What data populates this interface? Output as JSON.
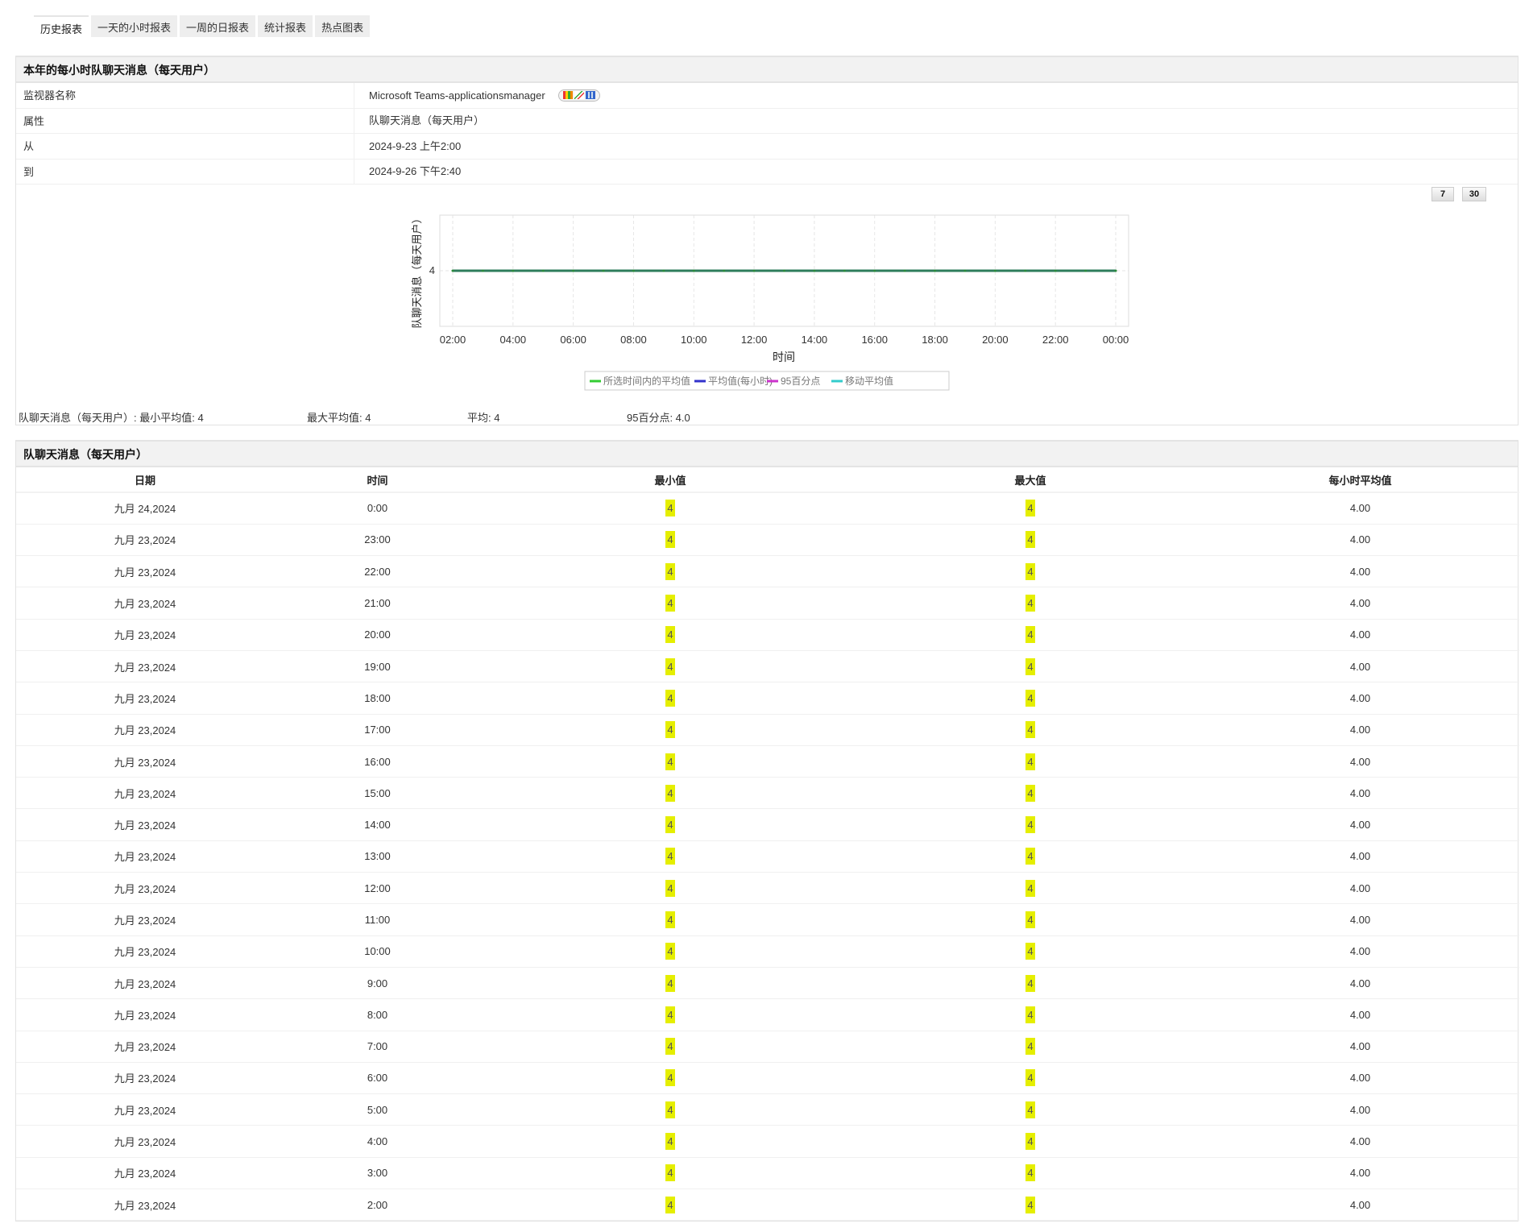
{
  "tabs": [
    "历史报表",
    "一天的小时报表",
    "一周的日报表",
    "统计报表",
    "热点图表"
  ],
  "panel1": {
    "title": "本年的每小时队聊天消息（每天用户）",
    "rows": [
      {
        "label": "监视器名称",
        "value": "Microsoft Teams-applicationsmanager"
      },
      {
        "label": "属性",
        "value": "队聊天消息（每天用户）"
      },
      {
        "label": "从",
        "value": "2024-9-23 上午2:00"
      },
      {
        "label": "到",
        "value": "2024-9-26 下午2:40"
      }
    ],
    "range_buttons": [
      "7",
      "30"
    ],
    "stats": {
      "min_label": "队聊天消息（每天用户）: 最小平均值: 4",
      "max_label": "最大平均值: 4",
      "avg_label": "平均: 4",
      "p95_label": "95百分点: 4.0"
    }
  },
  "chart_data": {
    "type": "line",
    "xlabel": "时间",
    "ylabel": "队聊天消息（每天用户）",
    "x": [
      "02:00",
      "03:00",
      "04:00",
      "05:00",
      "06:00",
      "07:00",
      "08:00",
      "09:00",
      "10:00",
      "11:00",
      "12:00",
      "13:00",
      "14:00",
      "15:00",
      "16:00",
      "17:00",
      "18:00",
      "19:00",
      "20:00",
      "21:00",
      "22:00",
      "23:00",
      "00:00"
    ],
    "x_ticks": [
      "02:00",
      "04:00",
      "06:00",
      "08:00",
      "10:00",
      "12:00",
      "14:00",
      "16:00",
      "18:00",
      "20:00",
      "22:00",
      "00:00"
    ],
    "y_ticks": [
      "4"
    ],
    "ylim": [
      3,
      5
    ],
    "series": [
      {
        "name": "所选时间内的平均值",
        "color": "#33cc33",
        "values": [
          4,
          4,
          4,
          4,
          4,
          4,
          4,
          4,
          4,
          4,
          4,
          4,
          4,
          4,
          4,
          4,
          4,
          4,
          4,
          4,
          4,
          4,
          4
        ]
      },
      {
        "name": "平均值(每小时)",
        "color": "#3333cc",
        "values": [
          4,
          4,
          4,
          4,
          4,
          4,
          4,
          4,
          4,
          4,
          4,
          4,
          4,
          4,
          4,
          4,
          4,
          4,
          4,
          4,
          4,
          4,
          4
        ]
      },
      {
        "name": "95百分点",
        "color": "#cc33cc",
        "values": [
          4,
          4,
          4,
          4,
          4,
          4,
          4,
          4,
          4,
          4,
          4,
          4,
          4,
          4,
          4,
          4,
          4,
          4,
          4,
          4,
          4,
          4,
          4
        ]
      },
      {
        "name": "移动平均值",
        "color": "#33cccc",
        "values": [
          4,
          4,
          4,
          4,
          4,
          4,
          4,
          4,
          4,
          4,
          4,
          4,
          4,
          4,
          4,
          4,
          4,
          4,
          4,
          4,
          4,
          4,
          4
        ]
      }
    ],
    "legend": "bottom"
  },
  "panel2": {
    "title": "队聊天消息（每天用户）",
    "columns": [
      "日期",
      "时间",
      "最小值",
      "最大值",
      "每小时平均值"
    ],
    "rows": [
      [
        "九月 24,2024",
        "0:00",
        "4",
        "4",
        "4.00"
      ],
      [
        "九月 23,2024",
        "23:00",
        "4",
        "4",
        "4.00"
      ],
      [
        "九月 23,2024",
        "22:00",
        "4",
        "4",
        "4.00"
      ],
      [
        "九月 23,2024",
        "21:00",
        "4",
        "4",
        "4.00"
      ],
      [
        "九月 23,2024",
        "20:00",
        "4",
        "4",
        "4.00"
      ],
      [
        "九月 23,2024",
        "19:00",
        "4",
        "4",
        "4.00"
      ],
      [
        "九月 23,2024",
        "18:00",
        "4",
        "4",
        "4.00"
      ],
      [
        "九月 23,2024",
        "17:00",
        "4",
        "4",
        "4.00"
      ],
      [
        "九月 23,2024",
        "16:00",
        "4",
        "4",
        "4.00"
      ],
      [
        "九月 23,2024",
        "15:00",
        "4",
        "4",
        "4.00"
      ],
      [
        "九月 23,2024",
        "14:00",
        "4",
        "4",
        "4.00"
      ],
      [
        "九月 23,2024",
        "13:00",
        "4",
        "4",
        "4.00"
      ],
      [
        "九月 23,2024",
        "12:00",
        "4",
        "4",
        "4.00"
      ],
      [
        "九月 23,2024",
        "11:00",
        "4",
        "4",
        "4.00"
      ],
      [
        "九月 23,2024",
        "10:00",
        "4",
        "4",
        "4.00"
      ],
      [
        "九月 23,2024",
        "9:00",
        "4",
        "4",
        "4.00"
      ],
      [
        "九月 23,2024",
        "8:00",
        "4",
        "4",
        "4.00"
      ],
      [
        "九月 23,2024",
        "7:00",
        "4",
        "4",
        "4.00"
      ],
      [
        "九月 23,2024",
        "6:00",
        "4",
        "4",
        "4.00"
      ],
      [
        "九月 23,2024",
        "5:00",
        "4",
        "4",
        "4.00"
      ],
      [
        "九月 23,2024",
        "4:00",
        "4",
        "4",
        "4.00"
      ],
      [
        "九月 23,2024",
        "3:00",
        "4",
        "4",
        "4.00"
      ],
      [
        "九月 23,2024",
        "2:00",
        "4",
        "4",
        "4.00"
      ]
    ],
    "highlight_color": "#e5ee00"
  }
}
